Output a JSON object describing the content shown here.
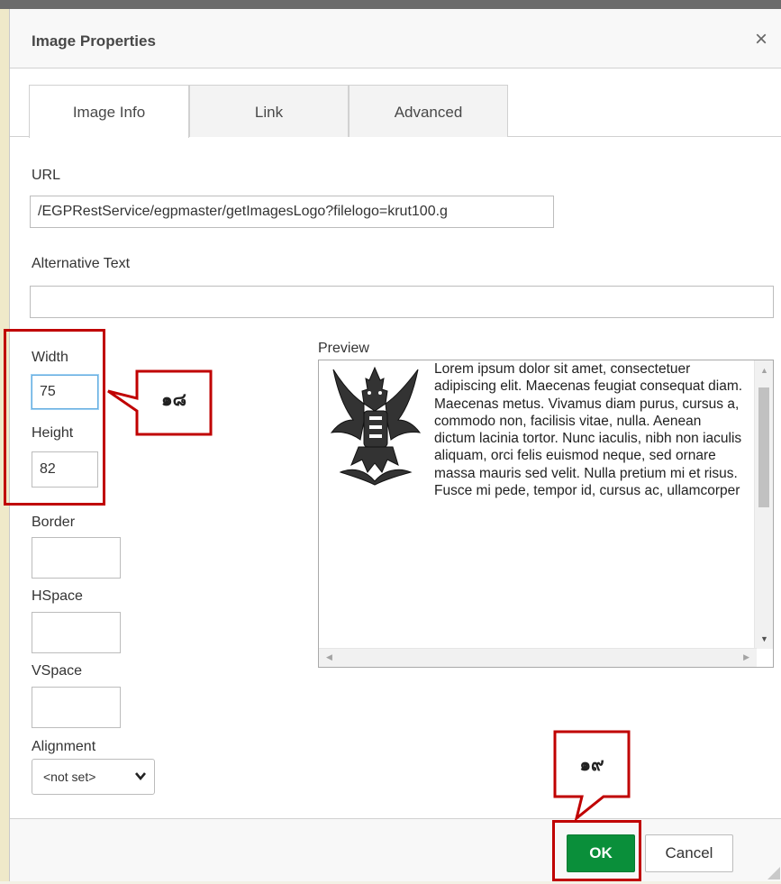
{
  "dialog": {
    "title": "Image Properties",
    "close_symbol": "×"
  },
  "tabs": [
    {
      "label": "Image Info",
      "active": true
    },
    {
      "label": "Link",
      "active": false
    },
    {
      "label": "Advanced",
      "active": false
    }
  ],
  "fields": {
    "url_label": "URL",
    "url_value": "/EGPRestService/egpmaster/getImagesLogo?filelogo=krut100.g",
    "alt_label": "Alternative Text",
    "alt_value": "",
    "width_label": "Width",
    "width_value": "75",
    "height_label": "Height",
    "height_value": "82",
    "border_label": "Border",
    "border_value": "",
    "hspace_label": "HSpace",
    "hspace_value": "",
    "vspace_label": "VSpace",
    "vspace_value": "",
    "alignment_label": "Alignment",
    "alignment_value": "<not set>"
  },
  "preview": {
    "label": "Preview",
    "text": "Lorem ipsum dolor sit amet, consectetuer adipiscing elit. Maecenas feugiat consequat diam. Maecenas metus. Vivamus diam purus, cursus a, commodo non, facilisis vitae, nulla. Aenean dictum lacinia tortor. Nunc iaculis, nibh non iaculis aliquam, orci felis euismod neque, sed ornare massa mauris sed velit. Nulla pretium mi et risus. Fusce mi pede, tempor id, cursus ac, ullamcorper"
  },
  "buttons": {
    "ok": "OK",
    "cancel": "Cancel"
  },
  "annotations": {
    "callout_18": "๑๘",
    "callout_19": "๑๙",
    "highlight_color": "#c00000"
  },
  "colors": {
    "ok_button": "#0a8f3a",
    "focus_border": "#66aee0"
  }
}
